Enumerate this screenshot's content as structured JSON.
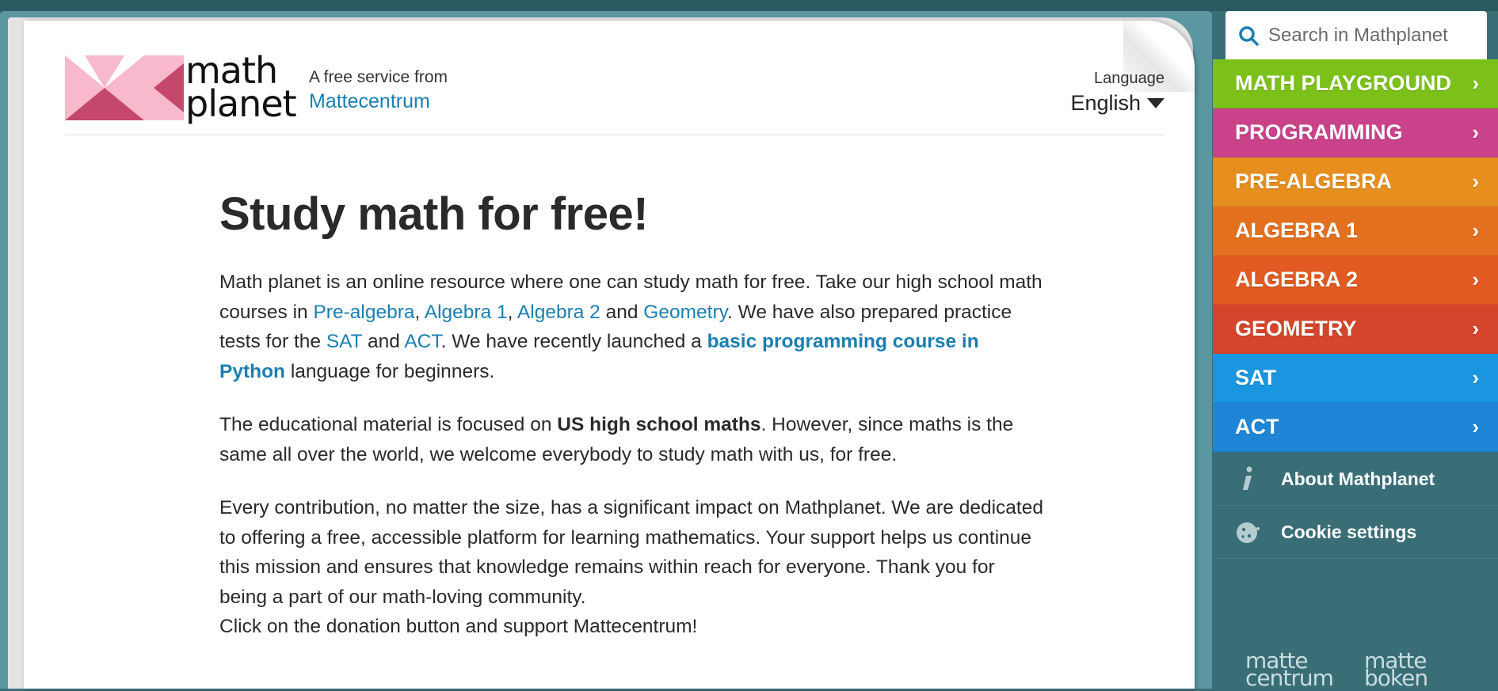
{
  "provider": {
    "label": "A free service from",
    "link": "Mattecentrum"
  },
  "logo": {
    "line1": "math",
    "line2": "planet"
  },
  "language": {
    "label": "Language",
    "value": "English"
  },
  "search": {
    "placeholder": "Search in Mathplanet"
  },
  "main": {
    "title": "Study math for free!",
    "p1": {
      "t1": "Math planet is an online resource where one can study math for free. Take our high school math courses in ",
      "l1": "Pre-algebra",
      "t2": ", ",
      "l2": "Algebra 1",
      "t3": ", ",
      "l3": "Algebra 2",
      "t4": " and ",
      "l4": "Geometry",
      "t5": ". We have also prepared practice tests for the ",
      "l5": "SAT",
      "t6": " and ",
      "l6": "ACT",
      "t7": ". We have recently launched a ",
      "l7": "basic programming course in Python",
      "t8": " language for beginners."
    },
    "p2": {
      "t1": "The educational material is focused on ",
      "b1": "US high school maths",
      "t2": ". However, since maths is the same all over the world, we welcome everybody to study math with us, for free."
    },
    "p3": "Every contribution, no matter the size, has a significant impact on Mathplanet. We are dedicated to offering a free, accessible platform for learning mathematics. Your support helps us continue this mission and ensures that knowledge remains within reach for everyone. Thank you for being a part of our math-loving community.",
    "p4": "Click on the donation button and support Mattecentrum!"
  },
  "menu": [
    {
      "label": "MATH PLAYGROUND",
      "color": "#7cc11a"
    },
    {
      "label": "PROGRAMMING",
      "color": "#c9428a"
    },
    {
      "label": "PRE-ALGEBRA",
      "color": "#e68e1e"
    },
    {
      "label": "ALGEBRA 1",
      "color": "#e2701f"
    },
    {
      "label": "ALGEBRA 2",
      "color": "#e05a22"
    },
    {
      "label": "GEOMETRY",
      "color": "#d4452b"
    },
    {
      "label": "SAT",
      "color": "#1a96e0"
    },
    {
      "label": "ACT",
      "color": "#1f85d6"
    }
  ],
  "sidebar_links": {
    "about": "About Mathplanet",
    "cookies": "Cookie settings"
  },
  "footer_brands": {
    "b1_line1": "matte",
    "b1_line2": "centrum",
    "b2_line1": "matte",
    "b2_line2": "boken"
  },
  "colors": {
    "link": "#1a7fb0",
    "sidebar_bg": "#3a6e77",
    "logo_pink": "#f7b9cb",
    "logo_red": "#c4486b"
  },
  "icons": {
    "search": "search-icon",
    "menu_arrow": "chevron-right-icon",
    "about": "info-icon",
    "cookies": "cookie-icon",
    "language": "caret-down-icon"
  }
}
